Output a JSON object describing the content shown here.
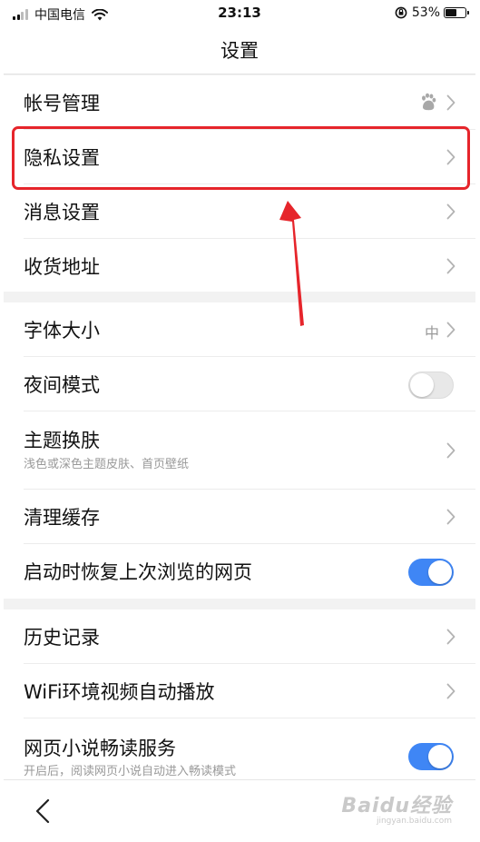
{
  "status_bar": {
    "carrier": "中国电信",
    "time": "23:13",
    "battery_text": "53%",
    "battery_level": 0.53,
    "signal_bars_filled": 2,
    "signal_bars_total": 4
  },
  "nav": {
    "title": "设置"
  },
  "groups": [
    {
      "items": [
        {
          "label": "帐号管理",
          "trailing": "chevron",
          "trailing_icon": "baidu-paw-icon"
        },
        {
          "label": "隐私设置",
          "trailing": "chevron",
          "highlighted": true
        },
        {
          "label": "消息设置",
          "trailing": "chevron"
        },
        {
          "label": "收货地址",
          "trailing": "chevron"
        }
      ]
    },
    {
      "items": [
        {
          "label": "字体大小",
          "value": "中",
          "trailing": "chevron"
        },
        {
          "label": "夜间模式",
          "trailing": "toggle",
          "toggle_on": false
        },
        {
          "label": "主题换肤",
          "subtitle": "浅色或深色主题皮肤、首页壁纸",
          "trailing": "chevron"
        },
        {
          "label": "清理缓存",
          "trailing": "chevron"
        },
        {
          "label": "启动时恢复上次浏览的网页",
          "trailing": "toggle",
          "toggle_on": true
        }
      ]
    },
    {
      "items": [
        {
          "label": "历史记录",
          "trailing": "chevron"
        },
        {
          "label": "WiFi环境视频自动播放",
          "trailing": "chevron"
        },
        {
          "label": "网页小说畅读服务",
          "subtitle": "开启后，阅读网页小说自动进入畅读模式",
          "trailing": "toggle",
          "toggle_on": true
        }
      ]
    }
  ],
  "bottom": {
    "watermark": "Baidu经验",
    "watermark_sub": "jingyan.baidu.com"
  },
  "colors": {
    "highlight_box": "#e6252b",
    "arrow": "#e6252b",
    "toggle_on": "#3f86f5",
    "page_bg": "#f2f2f2"
  }
}
